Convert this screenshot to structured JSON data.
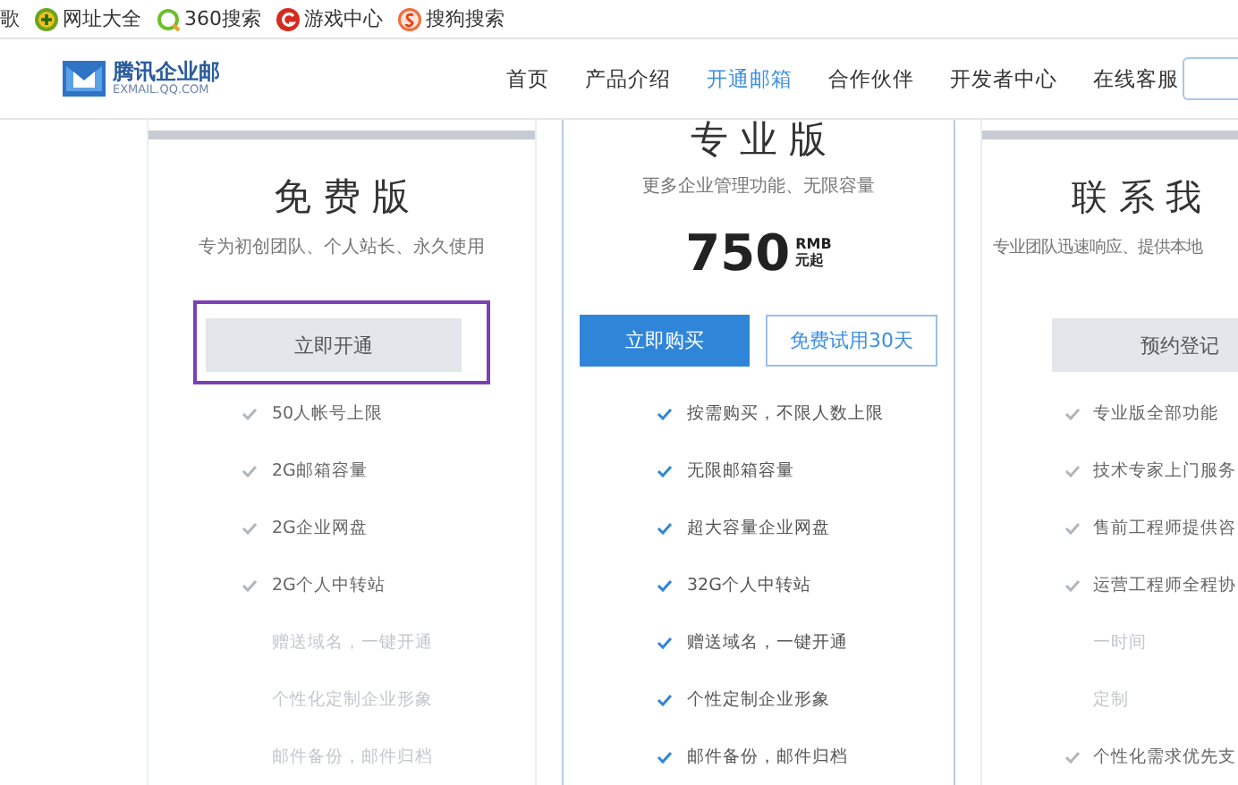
{
  "bookmarks": [
    {
      "label": "歌",
      "kind": "none"
    },
    {
      "label": "网址大全",
      "kind": "plus"
    },
    {
      "label": "360搜索",
      "kind": "ring"
    },
    {
      "label": "游戏中心",
      "kind": "g"
    },
    {
      "label": "搜狗搜索",
      "kind": "s"
    }
  ],
  "logo": {
    "name": "腾讯企业邮",
    "domain": "EXMAIL.QQ.COM"
  },
  "nav": [
    {
      "label": "首页",
      "selected": false
    },
    {
      "label": "产品介绍",
      "selected": false
    },
    {
      "label": "开通邮箱",
      "selected": true
    },
    {
      "label": "合作伙伴",
      "selected": false
    },
    {
      "label": "开发者中心",
      "selected": false
    },
    {
      "label": "在线客服",
      "selected": false
    }
  ],
  "plans": [
    {
      "kind": "basic",
      "title": "免 费 版",
      "subtitle": "专为初创团队、个人站长、永久使用",
      "highlighted": true,
      "buttons": [
        {
          "label": "立即开通",
          "kind": "gray"
        }
      ],
      "features": [
        {
          "label": "50人帐号上限",
          "included": true
        },
        {
          "label": "2G邮箱容量",
          "included": true
        },
        {
          "label": "2G企业网盘",
          "included": true
        },
        {
          "label": "2G个人中转站",
          "included": true
        },
        {
          "label": "赠送域名，一键开通",
          "included": false
        },
        {
          "label": "个性化定制企业形象",
          "included": false
        },
        {
          "label": "邮件备份，邮件归档",
          "included": false
        }
      ]
    },
    {
      "kind": "featured",
      "title": "专 业 版",
      "subtitle": "更多企业管理功能、无限容量",
      "price": {
        "amount": "750",
        "currency": "RMB",
        "unit": "元起"
      },
      "buttons": [
        {
          "label": "立即购买",
          "kind": "primary"
        },
        {
          "label": "免费试用30天",
          "kind": "outline"
        }
      ],
      "features": [
        {
          "label": "按需购买，不限人数上限",
          "included": true
        },
        {
          "label": "无限邮箱容量",
          "included": true
        },
        {
          "label": "超大容量企业网盘",
          "included": true
        },
        {
          "label": "32G个人中转站",
          "included": true
        },
        {
          "label": "赠送域名，一键开通",
          "included": true
        },
        {
          "label": "个性定制企业形象",
          "included": true
        },
        {
          "label": "邮件备份，邮件归档",
          "included": true
        }
      ]
    },
    {
      "kind": "basic",
      "title": "联 系 我",
      "subtitle": "专业团队迅速响应、提供本地",
      "highlighted": false,
      "buttons": [
        {
          "label": "预约登记",
          "kind": "gray"
        }
      ],
      "features": [
        {
          "label": "专业版全部功能",
          "included": true
        },
        {
          "label": "技术专家上门服务",
          "included": true
        },
        {
          "label": "售前工程师提供咨",
          "included": true
        },
        {
          "label": "运营工程师全程协",
          "included": true
        },
        {
          "label": "一时间",
          "included": false
        },
        {
          "label": "定制",
          "included": false
        },
        {
          "label": "个性化需求优先支",
          "included": true
        }
      ]
    }
  ]
}
